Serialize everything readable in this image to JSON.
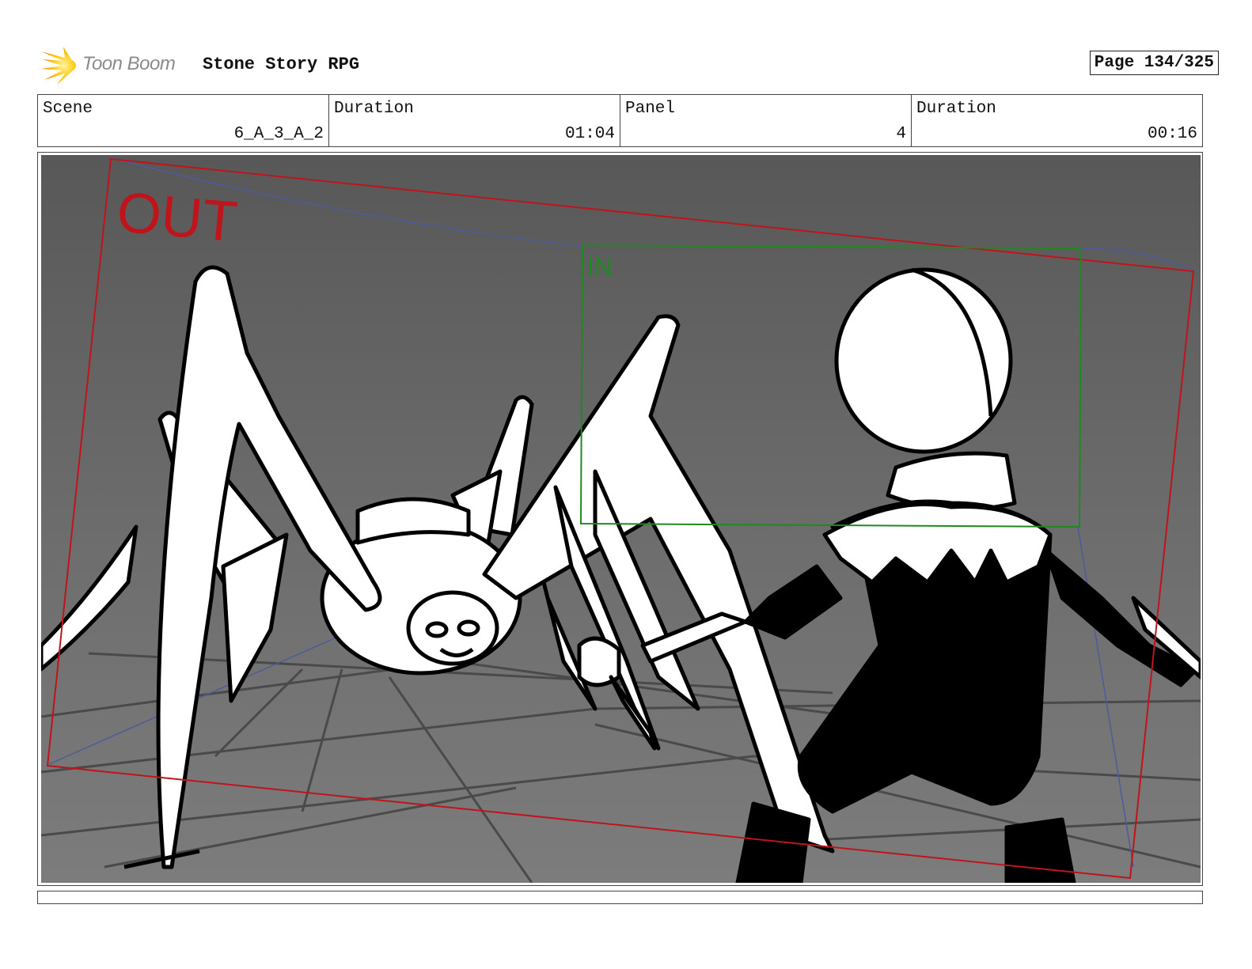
{
  "header": {
    "logo_text": "Toon Boom",
    "project_title": "Stone Story RPG",
    "page_label": "Page 134/325"
  },
  "info": [
    {
      "label": "Scene",
      "value": "6_A_3_A_2"
    },
    {
      "label": "Duration",
      "value": "01:04"
    },
    {
      "label": "Panel",
      "value": "4"
    },
    {
      "label": "Duration",
      "value": "00:16"
    }
  ],
  "panel": {
    "out_label": "OUT",
    "in_label": "IN",
    "colors": {
      "out_frame": "#c0141c",
      "in_frame": "#1e8a1e",
      "guide_line": "#4f5a9a",
      "floor": "#777777",
      "ink": "#000000",
      "fill": "#ffffff"
    }
  },
  "notes": ""
}
